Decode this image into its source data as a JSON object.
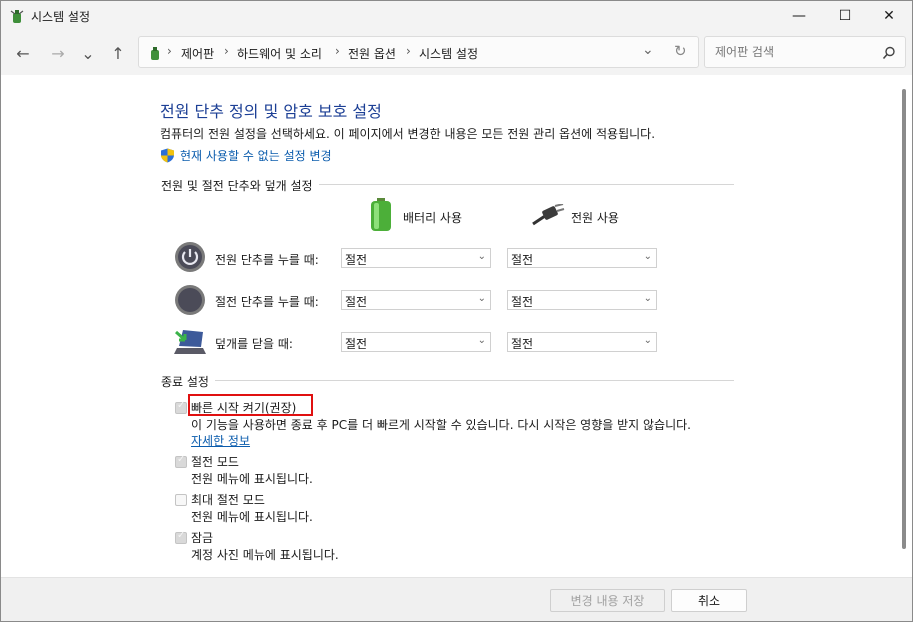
{
  "window": {
    "title": "시스템 설정"
  },
  "titlebar": {
    "minimize": "—",
    "maximize": "☐",
    "close": "✕"
  },
  "nav": {
    "back": "←",
    "forward": "→",
    "recent": "⌄",
    "up": "↑",
    "breadcrumbs": [
      "제어판",
      "하드웨어 및 소리",
      "전원 옵션",
      "시스템 설정"
    ],
    "separator": "›",
    "dropdown": "⌄",
    "refresh": "↻",
    "search_placeholder": "제어판 검색"
  },
  "main": {
    "heading": "전원 단추 정의 및 암호 보호 설정",
    "description": "컴퓨터의 전원 설정을 선택하세요. 이 페이지에서 변경한 내용은 모든 전원 관리 옵션에 적용됩니다.",
    "admin_link": "현재 사용할 수 없는 설정 변경",
    "power_section": {
      "title": "전원 및 절전 단추와 덮개 설정",
      "battery_label": "배터리 사용",
      "plugged_label": "전원 사용",
      "rows": [
        {
          "label": "전원 단추를 누를 때:",
          "battery": "절전",
          "plugged": "절전"
        },
        {
          "label": "절전 단추를 누를 때:",
          "battery": "절전",
          "plugged": "절전"
        },
        {
          "label": "덮개를 닫을 때:",
          "battery": "절전",
          "plugged": "절전"
        }
      ]
    },
    "shutdown_section": {
      "title": "종료 설정",
      "options": [
        {
          "label": "빠른 시작 켜기(권장)",
          "desc": "이 기능을 사용하면 종료 후 PC를 더 빠르게 시작할 수 있습니다. 다시 시작은 영향을 받지 않습니다.",
          "link": "자세한 정보",
          "checked": true
        },
        {
          "label": "절전 모드",
          "desc": "전원 메뉴에 표시됩니다.",
          "checked": true
        },
        {
          "label": "최대 절전 모드",
          "desc": "전원 메뉴에 표시됩니다.",
          "checked": false
        },
        {
          "label": "잠금",
          "desc": "계정 사진 메뉴에 표시됩니다.",
          "checked": true
        }
      ]
    }
  },
  "footer": {
    "save": "변경 내용 저장",
    "cancel": "취소"
  },
  "colors": {
    "heading": "#1c3f95",
    "link": "#0b5cad",
    "highlight": "#e01010"
  }
}
